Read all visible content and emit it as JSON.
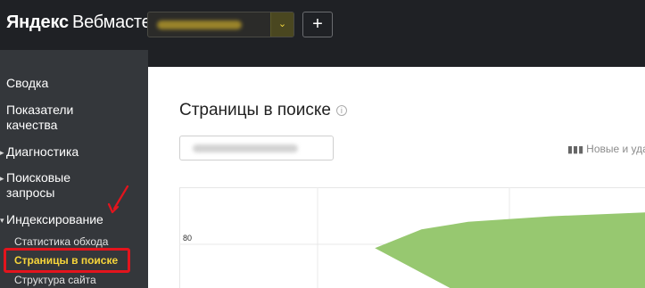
{
  "header": {
    "brand": "Яндекс",
    "product": "Вебмастер",
    "add_button_label": "+"
  },
  "sidebar": {
    "items": [
      {
        "label": "Сводка"
      },
      {
        "label": "Показатели качества"
      },
      {
        "label": "Диагностика"
      },
      {
        "label": "Поисковые запросы"
      },
      {
        "label": "Индексирование"
      }
    ],
    "subitems": [
      {
        "label": "Статистика обхода"
      },
      {
        "label": "Страницы в поиске"
      },
      {
        "label": "Структура сайта"
      }
    ]
  },
  "main": {
    "title": "Страницы в поиске",
    "info_icon_glyph": "i",
    "filter_label": "Новые и уда"
  },
  "chart_data": {
    "type": "area",
    "y_ticks": [
      "80"
    ],
    "x": [
      0.0,
      0.3,
      0.42,
      0.52,
      0.62,
      0.8,
      1.0
    ],
    "values": [
      null,
      55,
      78,
      88,
      92,
      95,
      97
    ],
    "series_color": "#97c870"
  },
  "colors": {
    "topbar": "#1f2125",
    "sidebar": "#34373b",
    "active_nav": "#f7d53a",
    "highlight": "#e3141d",
    "chart_fill": "#97c870"
  }
}
